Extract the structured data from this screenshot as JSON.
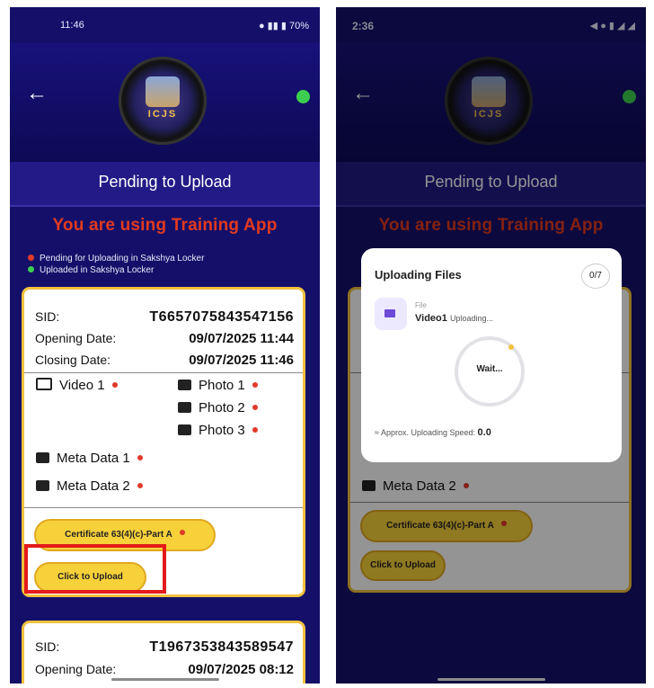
{
  "left": {
    "status": {
      "time": "11:46",
      "right": "70%"
    },
    "title": "Pending to Upload",
    "warning": "You are using Training App",
    "legend": {
      "pending": "Pending for Uploading in Sakshya Locker",
      "uploaded": "Uploaded in Sakshya Locker",
      "pending_color": "#e03a2a",
      "uploaded_color": "#3ccf4f"
    },
    "card1": {
      "sid_label": "SID:",
      "sid_value": "T6657075843547156",
      "opening_label": "Opening Date:",
      "opening_value": "09/07/2025 11:44",
      "closing_label": "Closing Date:",
      "closing_value": "09/07/2025 11:46",
      "video1": "Video 1",
      "photo1": "Photo 1",
      "photo2": "Photo 2",
      "photo3": "Photo 3",
      "meta1": "Meta Data 1",
      "meta2": "Meta Data 2",
      "certificate": "Certificate 63(4)(c)-Part A",
      "upload": "Click to Upload"
    },
    "card2": {
      "sid_label": "SID:",
      "sid_value": "T1967353843589547",
      "opening_label": "Opening Date:",
      "opening_value": "09/07/2025 08:12"
    }
  },
  "right": {
    "status": {
      "time": "2:36"
    },
    "title": "Pending to Upload",
    "warning": "You are using Training App",
    "meta2": "Meta Data 2",
    "certificate": "Certificate 63(4)(c)-Part A",
    "upload": "Click to Upload",
    "modal": {
      "title": "Uploading Files",
      "count": "0/7",
      "file_label": "File",
      "file_name": "Video1",
      "file_status": "Uploading...",
      "wait": "Wait...",
      "speed_label": "Approx. Uploading Speed:",
      "speed_value": "0.0"
    }
  }
}
